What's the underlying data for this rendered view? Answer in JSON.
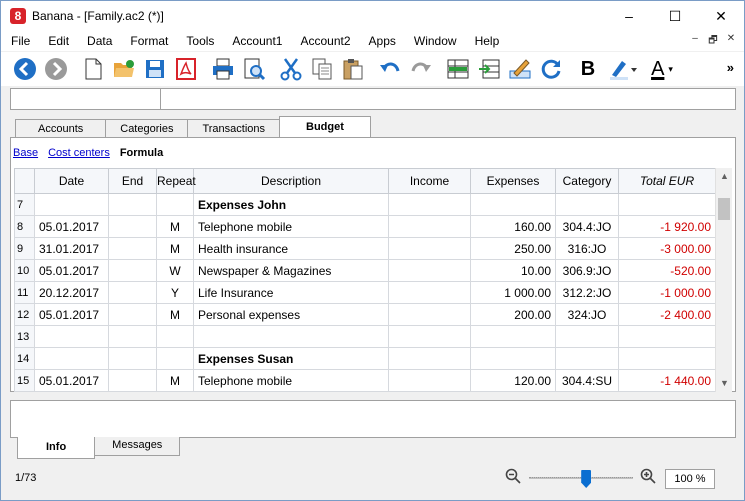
{
  "window": {
    "title": "Banana - [Family.ac2 (*)]",
    "app_icon_glyph": "8",
    "controls": {
      "minimize": "–",
      "maximize": "☐",
      "close": "✕"
    }
  },
  "menu": {
    "items": [
      "File",
      "Edit",
      "Data",
      "Format",
      "Tools",
      "Account1",
      "Account2",
      "Apps",
      "Window",
      "Help"
    ],
    "mdi": {
      "minimize": "–",
      "restore": "🗗",
      "close": "✕"
    }
  },
  "toolbar": {
    "icons": [
      "back-icon",
      "forward-icon",
      "new-file-icon",
      "open-folder-icon",
      "save-icon",
      "pdf-icon",
      "print-icon",
      "print-preview-icon",
      "cut-icon",
      "copy-icon",
      "paste-icon",
      "undo-icon",
      "redo-icon",
      "add-row-icon",
      "move-row-icon",
      "edit-pen-icon",
      "recheck-icon",
      "bold-icon",
      "highlight-color-icon",
      "font-color-icon"
    ],
    "bold_label": "B",
    "font_color_label": "A",
    "more_label": "»",
    "accent_blue": "#1f6fc5"
  },
  "tabs": [
    "Accounts",
    "Categories",
    "Transactions",
    "Budget"
  ],
  "active_tab": "Budget",
  "views": {
    "base": "Base",
    "cost_centers": "Cost centers",
    "formula": "Formula"
  },
  "table": {
    "headers": [
      "",
      "Date",
      "End",
      "Repeat",
      "Description",
      "Income",
      "Expenses",
      "Category",
      "Total EUR"
    ],
    "rows": [
      {
        "num": "7",
        "date": "",
        "end": "",
        "repeat": "",
        "desc": "Expenses John",
        "income": "",
        "expenses": "",
        "category": "",
        "total": "",
        "bold": true
      },
      {
        "num": "8",
        "date": "05.01.2017",
        "end": "",
        "repeat": "M",
        "desc": "Telephone mobile",
        "income": "",
        "expenses": "160.00",
        "category": "304.4:JO",
        "total": "-1 920.00"
      },
      {
        "num": "9",
        "date": "31.01.2017",
        "end": "",
        "repeat": "M",
        "desc": "Health insurance",
        "income": "",
        "expenses": "250.00",
        "category": "316:JO",
        "total": "-3 000.00"
      },
      {
        "num": "10",
        "date": "05.01.2017",
        "end": "",
        "repeat": "W",
        "desc": "Newspaper & Magazines",
        "income": "",
        "expenses": "10.00",
        "category": "306.9:JO",
        "total": "-520.00"
      },
      {
        "num": "11",
        "date": "20.12.2017",
        "end": "",
        "repeat": "Y",
        "desc": "Life Insurance",
        "income": "",
        "expenses": "1 000.00",
        "category": "312.2:JO",
        "total": "-1 000.00"
      },
      {
        "num": "12",
        "date": "05.01.2017",
        "end": "",
        "repeat": "M",
        "desc": "Personal expenses",
        "income": "",
        "expenses": "200.00",
        "category": "324:JO",
        "total": "-2 400.00"
      },
      {
        "num": "13",
        "date": "",
        "end": "",
        "repeat": "",
        "desc": "",
        "income": "",
        "expenses": "",
        "category": "",
        "total": ""
      },
      {
        "num": "14",
        "date": "",
        "end": "",
        "repeat": "",
        "desc": "Expenses Susan",
        "income": "",
        "expenses": "",
        "category": "",
        "total": "",
        "bold": true
      },
      {
        "num": "15",
        "date": "05.01.2017",
        "end": "",
        "repeat": "M",
        "desc": "Telephone mobile",
        "income": "",
        "expenses": "120.00",
        "category": "304.4:SU",
        "total": "-1 440.00"
      }
    ],
    "negative_color": "#d00000"
  },
  "bottom_tabs": [
    "Info",
    "Messages"
  ],
  "active_bottom_tab": "Info",
  "status": {
    "position": "1/73",
    "zoom": "100 %",
    "zoom_level_fraction": 0.55
  }
}
